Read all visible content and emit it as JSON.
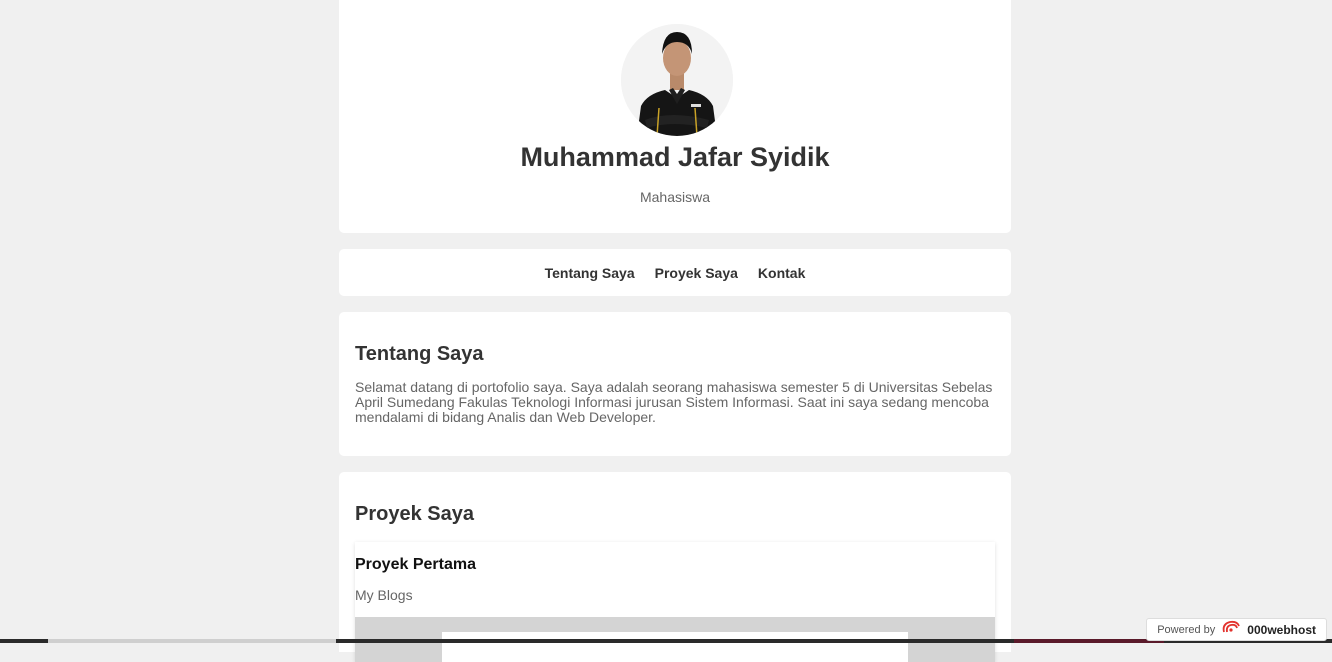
{
  "profile": {
    "name": "Muhammad Jafar Syidik",
    "role": "Mahasiswa"
  },
  "nav": {
    "items": [
      {
        "label": "Tentang Saya"
      },
      {
        "label": "Proyek Saya"
      },
      {
        "label": "Kontak"
      }
    ]
  },
  "about": {
    "title": "Tentang Saya",
    "text": "Selamat datang di portofolio saya. Saya adalah seorang mahasiswa semester 5 di Universitas Sebelas April Sumedang Fakulas Teknologi Informasi jurusan Sistem Informasi. Saat ini saya sedang mencoba mendalami di bidang Analis dan Web Developer."
  },
  "projects": {
    "title": "Proyek Saya",
    "items": [
      {
        "title": "Proyek Pertama",
        "description": "My Blogs"
      }
    ]
  },
  "badge": {
    "powered_by": "Powered by",
    "brand": "000webhost",
    "icon": "webhost-logo-icon"
  },
  "colors": {
    "background": "#f0f0f0",
    "card": "#ffffff",
    "heading": "#333333",
    "muted": "#666666",
    "brand_accent": "#e2322d"
  }
}
